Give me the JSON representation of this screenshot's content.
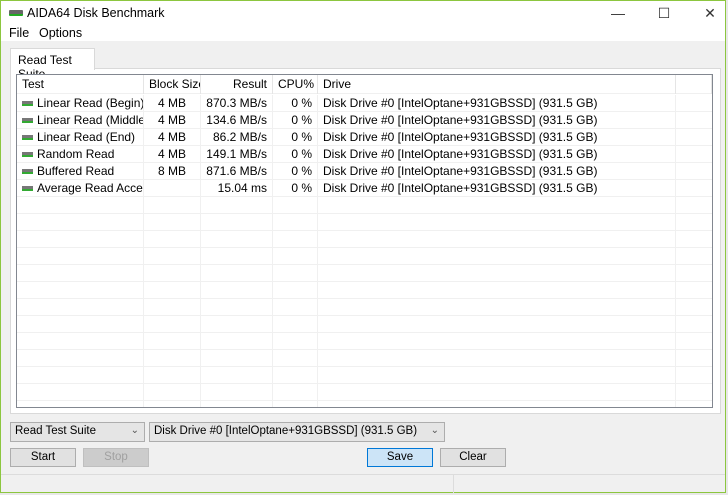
{
  "window": {
    "title": "AIDA64 Disk Benchmark",
    "accent": "#8cc63f"
  },
  "menu": [
    "File",
    "Options"
  ],
  "tab": "Read Test Suite",
  "columns": [
    "Test",
    "Block Size",
    "Result",
    "CPU%",
    "Drive"
  ],
  "rows": [
    {
      "test": "Linear Read (Begin)",
      "block": "4 MB",
      "result": "870.3 MB/s",
      "cpu": "0 %",
      "drive": "Disk Drive #0  [IntelOptane+931GBSSD]  (931.5 GB)"
    },
    {
      "test": "Linear Read (Middle)",
      "block": "4 MB",
      "result": "134.6 MB/s",
      "cpu": "0 %",
      "drive": "Disk Drive #0  [IntelOptane+931GBSSD]  (931.5 GB)"
    },
    {
      "test": "Linear Read (End)",
      "block": "4 MB",
      "result": "86.2 MB/s",
      "cpu": "0 %",
      "drive": "Disk Drive #0  [IntelOptane+931GBSSD]  (931.5 GB)"
    },
    {
      "test": "Random Read",
      "block": "4 MB",
      "result": "149.1 MB/s",
      "cpu": "0 %",
      "drive": "Disk Drive #0  [IntelOptane+931GBSSD]  (931.5 GB)"
    },
    {
      "test": "Buffered Read",
      "block": "8 MB",
      "result": "871.6 MB/s",
      "cpu": "0 %",
      "drive": "Disk Drive #0  [IntelOptane+931GBSSD]  (931.5 GB)"
    },
    {
      "test": "Average Read Access",
      "block": "",
      "result": "15.04 ms",
      "cpu": "0 %",
      "drive": "Disk Drive #0  [IntelOptane+931GBSSD]  (931.5 GB)"
    }
  ],
  "controls": {
    "suite": "Read Test Suite",
    "drive": "Disk Drive #0  [IntelOptane+931GBSSD]  (931.5 GB)",
    "start": "Start",
    "stop": "Stop",
    "save": "Save",
    "clear": "Clear"
  }
}
